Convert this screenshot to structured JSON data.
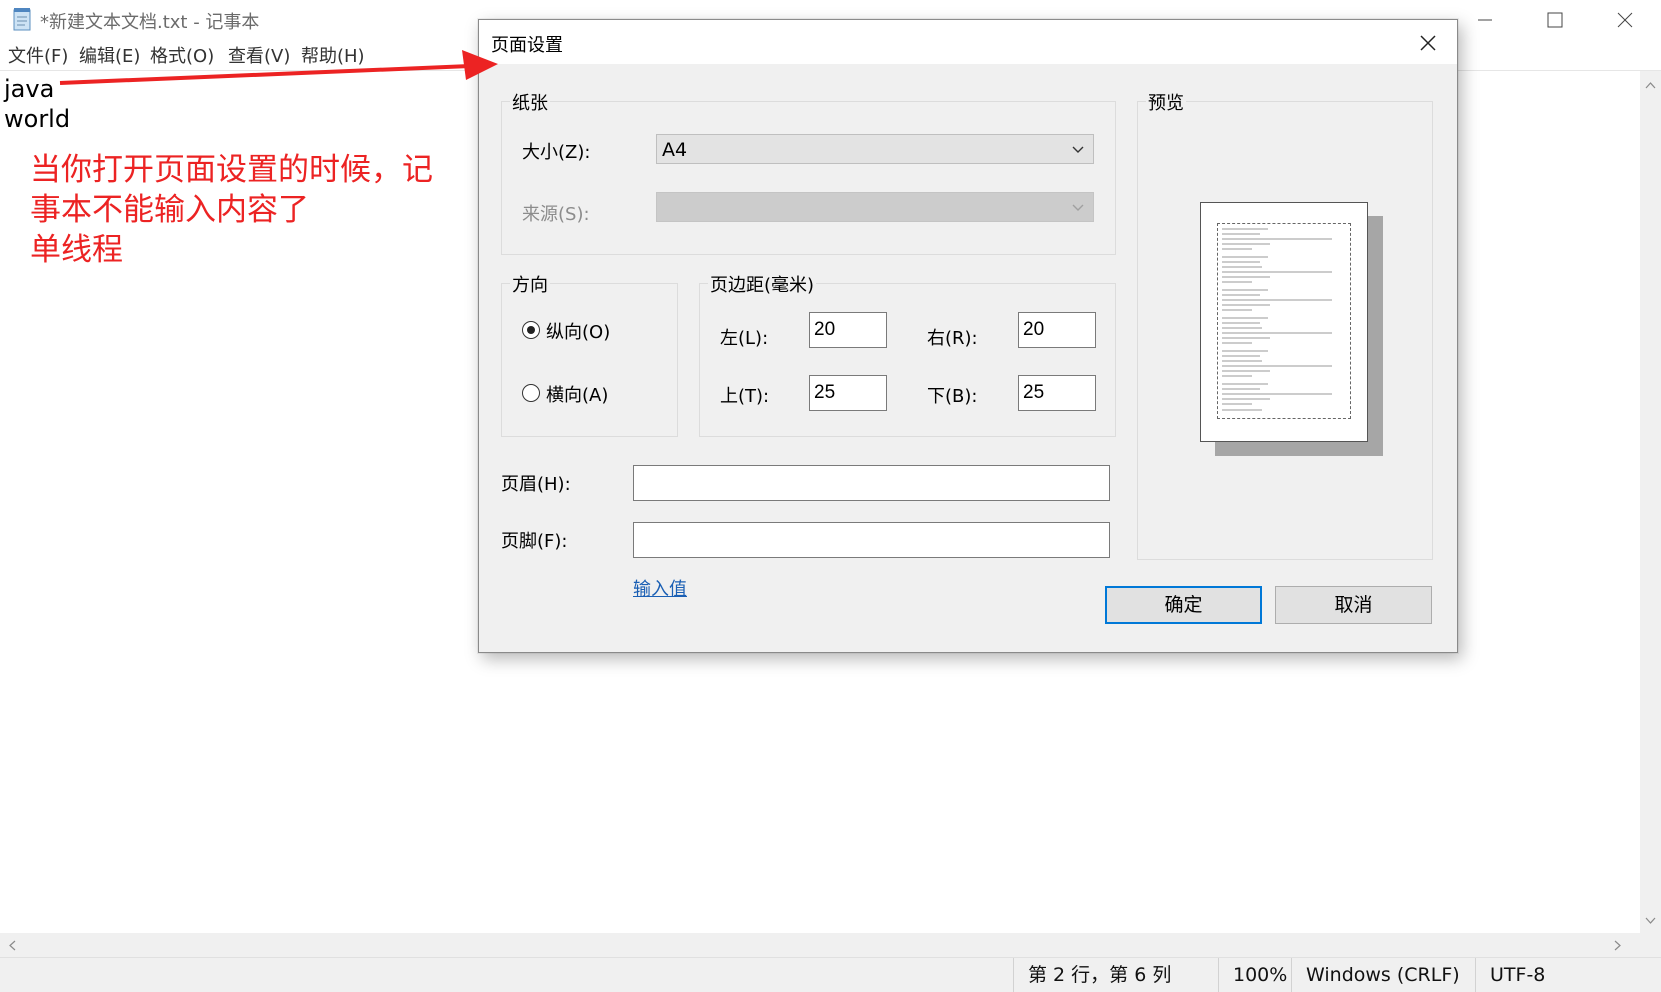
{
  "notepad": {
    "title": "*新建文本文档.txt - 记事本",
    "menu": [
      "文件(F)",
      "编辑(E)",
      "格式(O)",
      "查看(V)",
      "帮助(H)"
    ],
    "lines": [
      "java",
      "world"
    ],
    "status": {
      "position": "第 2 行，第 6 列",
      "zoom": "100%",
      "line_ending": "Windows (CRLF)",
      "encoding": "UTF-8"
    }
  },
  "annotation": {
    "text": "当你打开页面设置的时候，记\n事本不能输入内容了\n单线程",
    "color": "#ec2323"
  },
  "dialog": {
    "title": "页面设置",
    "paper": {
      "group_label": "纸张",
      "size_label": "大小(Z):",
      "size_value": "A4",
      "source_label": "来源(S):",
      "source_value": ""
    },
    "orientation": {
      "group_label": "方向",
      "portrait_label": "纵向(O)",
      "landscape_label": "横向(A)",
      "selected": "portrait"
    },
    "margins": {
      "group_label": "页边距(毫米)",
      "left_label": "左(L):",
      "left_value": "20",
      "right_label": "右(R):",
      "right_value": "20",
      "top_label": "上(T):",
      "top_value": "25",
      "bottom_label": "下(B):",
      "bottom_value": "25"
    },
    "header_label": "页眉(H):",
    "header_value": "",
    "footer_label": "页脚(F):",
    "footer_value": "",
    "input_link": "输入值",
    "preview_label": "预览",
    "ok_label": "确定",
    "cancel_label": "取消",
    "accent_color": "#0078d7"
  }
}
